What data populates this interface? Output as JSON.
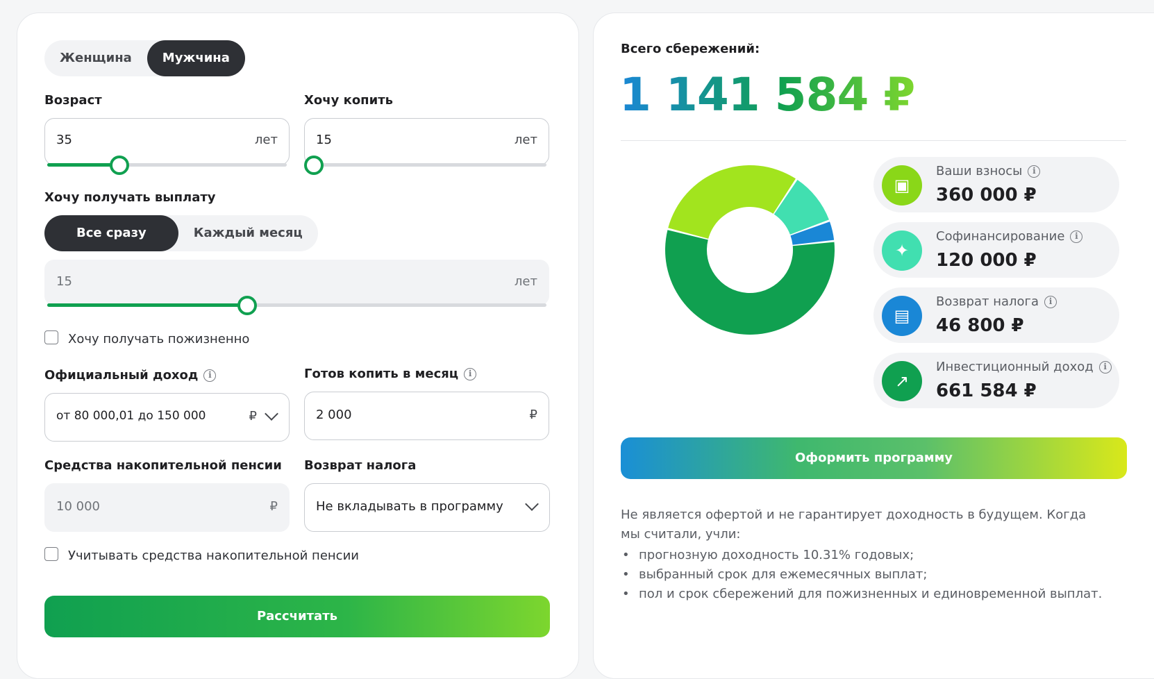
{
  "gender": {
    "female": "Женщина",
    "male": "Мужчина",
    "selected": "male"
  },
  "age": {
    "label": "Возраст",
    "value": "35",
    "unit": "лет",
    "fraction": 0.3
  },
  "save_years": {
    "label": "Хочу копить",
    "value": "15",
    "unit": "лет",
    "fraction": 0
  },
  "payout": {
    "label": "Хочу получать выплату",
    "opt_all": "Все сразу",
    "opt_monthly": "Каждый месяц",
    "selected": "all",
    "years_value": "15",
    "years_unit": "лет",
    "fraction": 0.4
  },
  "lifelong": {
    "label": "Хочу получать пожизненно",
    "checked": false
  },
  "income": {
    "label": "Официальный доход",
    "value": "от 80 000,01 до 150 000",
    "currency": "₽"
  },
  "monthly": {
    "label": "Готов копить в месяц",
    "value": "2 000",
    "currency": "₽"
  },
  "pension": {
    "label": "Средства накопительной пенсии",
    "value": "10 000",
    "currency": "₽"
  },
  "tax": {
    "label": "Возврат налога",
    "value": "Не вкладывать в программу"
  },
  "use_pension": {
    "label": "Учитывать средства накопительной пенсии",
    "checked": false
  },
  "calc_button": "Рассчитать",
  "total": {
    "label": "Всего сбережений:",
    "value": "1 141 584 ₽"
  },
  "stats": [
    {
      "title": "Ваши взносы",
      "value": "360 000 ₽",
      "color": "#8ad718",
      "icon": "wallet-icon",
      "glyph": "▣"
    },
    {
      "title": "Софинансирование",
      "value": "120 000 ₽",
      "color": "#41dfb0",
      "icon": "emblem-icon",
      "glyph": "✦"
    },
    {
      "title": "Возврат налога",
      "value": "46 800 ₽",
      "color": "#1a87d6",
      "icon": "receipt-icon",
      "glyph": "▤"
    },
    {
      "title": "Инвестиционный доход",
      "value": "661 584 ₽",
      "color": "#10a050",
      "icon": "trend-up-icon",
      "glyph": "↗"
    }
  ],
  "cta_button": "Оформить программу",
  "disclaimer": {
    "intro": "Не является офертой и не гарантирует доходность в будущем. Когда мы считали, учли:",
    "items": [
      "прогнозную доходность 10.31% годовых;",
      "выбранный срок для ежемесячных выплат;",
      "пол и срок сбережений для пожизненных и единовременной выплат."
    ]
  },
  "chart_data": {
    "type": "pie",
    "categories": [
      "Ваши взносы",
      "Софинансирование",
      "Возврат налога",
      "Инвестиционный доход"
    ],
    "values": [
      360000,
      120000,
      46800,
      661584
    ],
    "colors": [
      "#a2e41e",
      "#41dfb0",
      "#1a87d6",
      "#10a050"
    ],
    "donut": true
  }
}
